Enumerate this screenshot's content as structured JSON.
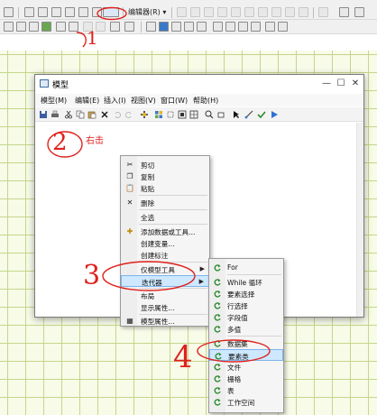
{
  "top_menu": {
    "items": [
      "",
      ""
    ]
  },
  "toolbar1": {
    "editor_label": "编辑器(R) ▾"
  },
  "model_window": {
    "title": "模型",
    "controls": {
      "minimize": "—",
      "maximize": "☐",
      "close": "✕"
    },
    "menu": [
      "模型(M)",
      "编辑(E)",
      "插入(I)",
      "视图(V)",
      "窗口(W)",
      "帮助(H)"
    ]
  },
  "annotations": {
    "step1": "1",
    "step2": "2",
    "step2_text": "右击",
    "step3": "3",
    "step4": "4"
  },
  "context_menu": {
    "items": [
      {
        "label": "剪切",
        "icon": "scissors-icon"
      },
      {
        "label": "复制",
        "icon": "copy-icon"
      },
      {
        "label": "粘贴",
        "icon": "paste-icon"
      },
      {
        "label": "删除",
        "icon": "delete-icon"
      },
      {
        "label": "全选",
        "icon": ""
      },
      {
        "label": "添加数据或工具...",
        "icon": "add-data-icon"
      },
      {
        "label": "创建变量...",
        "icon": ""
      },
      {
        "label": "创建标注",
        "icon": ""
      },
      {
        "label": "仅模型工具",
        "icon": ""
      },
      {
        "label": "迭代器",
        "icon": ""
      },
      {
        "label": "布局",
        "icon": ""
      },
      {
        "label": "显示属性...",
        "icon": ""
      },
      {
        "label": "模型属性...",
        "icon": "properties-icon"
      }
    ]
  },
  "submenu": {
    "items": [
      "For",
      "While 循环",
      "要素选择",
      "行选择",
      "字段值",
      "多值",
      "数据集",
      "要素类",
      "文件",
      "栅格",
      "表",
      "工作空间"
    ]
  },
  "colors": {
    "accent_red": "#e0201c",
    "grid": "#c6d68a",
    "highlight": "#cde8ff"
  }
}
